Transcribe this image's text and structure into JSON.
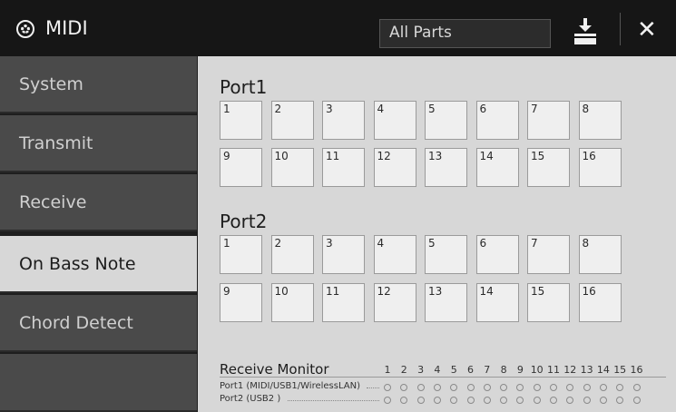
{
  "header": {
    "title": "MIDI",
    "parts_select": "All Parts",
    "icons": [
      "midi-icon",
      "download-icon",
      "close-icon"
    ]
  },
  "sidebar": {
    "items": [
      {
        "label": "System",
        "active": false
      },
      {
        "label": "Transmit",
        "active": false
      },
      {
        "label": "Receive",
        "active": false
      },
      {
        "label": "On Bass Note",
        "active": true
      },
      {
        "label": "Chord Detect",
        "active": false
      }
    ]
  },
  "ports": [
    {
      "label": "Port1",
      "channels": [
        "1",
        "2",
        "3",
        "4",
        "5",
        "6",
        "7",
        "8",
        "9",
        "10",
        "11",
        "12",
        "13",
        "14",
        "15",
        "16"
      ]
    },
    {
      "label": "Port2",
      "channels": [
        "1",
        "2",
        "3",
        "4",
        "5",
        "6",
        "7",
        "8",
        "9",
        "10",
        "11",
        "12",
        "13",
        "14",
        "15",
        "16"
      ]
    }
  ],
  "monitor": {
    "title": "Receive Monitor",
    "channels": [
      "1",
      "2",
      "3",
      "4",
      "5",
      "6",
      "7",
      "8",
      "9",
      "10",
      "11",
      "12",
      "13",
      "14",
      "15",
      "16"
    ],
    "rows": [
      {
        "label": "Port1 (MIDI/USB1/WirelessLAN)"
      },
      {
        "label": "Port2 (USB2 )"
      }
    ]
  }
}
